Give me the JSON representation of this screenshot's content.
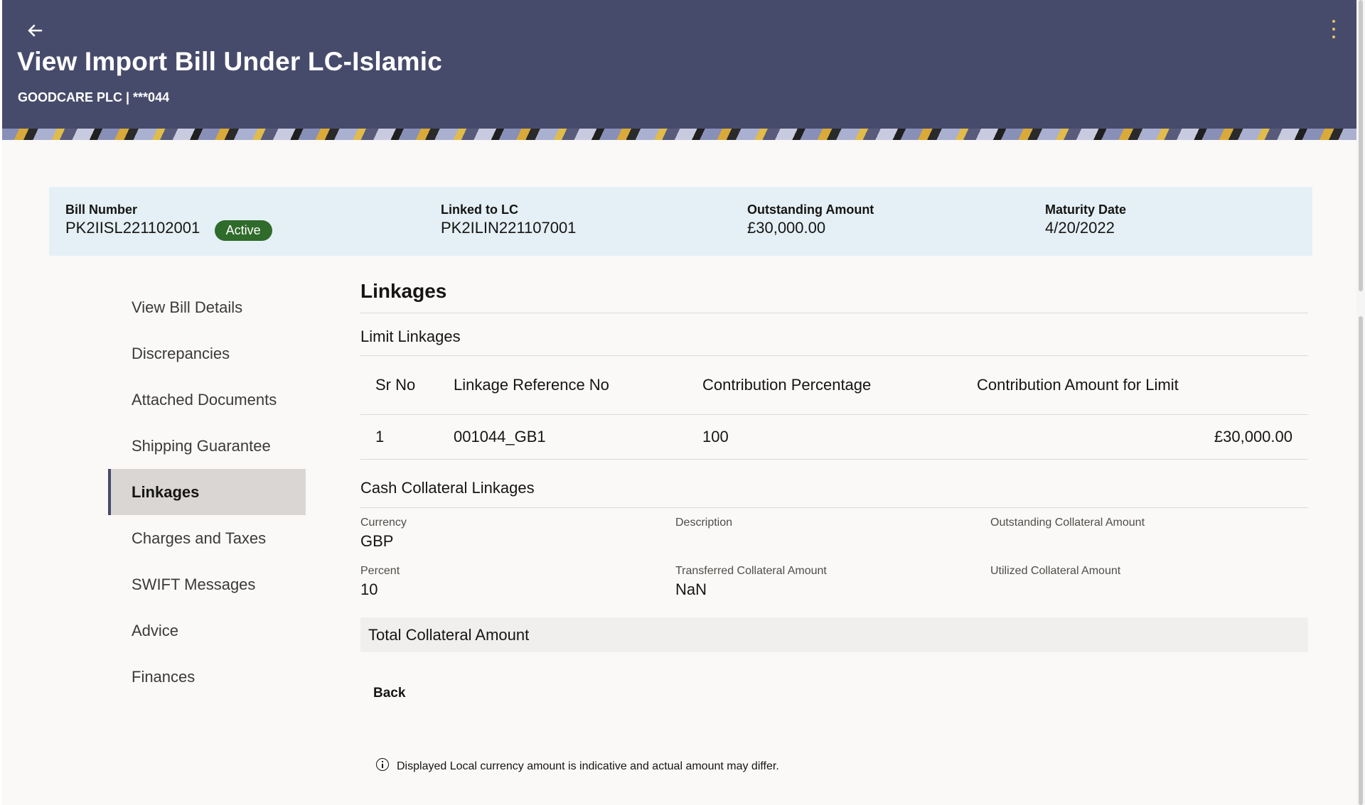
{
  "header": {
    "title": "View Import Bill Under LC-Islamic",
    "subtitle": "GOODCARE PLC | ***044"
  },
  "summary": {
    "bill_number_label": "Bill Number",
    "bill_number": "PK2IISL221102001",
    "status": "Active",
    "linked_lc_label": "Linked to LC",
    "linked_lc": "PK2ILIN221107001",
    "outstanding_label": "Outstanding Amount",
    "outstanding": "£30,000.00",
    "maturity_label": "Maturity Date",
    "maturity": "4/20/2022"
  },
  "sidenav": {
    "items": [
      {
        "label": "View Bill Details"
      },
      {
        "label": "Discrepancies"
      },
      {
        "label": "Attached Documents"
      },
      {
        "label": "Shipping Guarantee"
      },
      {
        "label": "Linkages",
        "active": true
      },
      {
        "label": "Charges and Taxes"
      },
      {
        "label": "SWIFT Messages"
      },
      {
        "label": "Advice"
      },
      {
        "label": "Finances"
      }
    ]
  },
  "linkages": {
    "title": "Linkages",
    "limit_title": "Limit Linkages",
    "limit_table": {
      "headers": [
        "Sr No",
        "Linkage Reference No",
        "Contribution Percentage",
        "Contribution Amount for Limit"
      ],
      "rows": [
        [
          "1",
          "001044_GB1",
          "100",
          "£30,000.00"
        ]
      ]
    },
    "cash_title": "Cash Collateral Linkages",
    "cash_fields": [
      {
        "label": "Currency",
        "value": "GBP"
      },
      {
        "label": "Description",
        "value": ""
      },
      {
        "label": "Outstanding Collateral Amount",
        "value": ""
      },
      {
        "label": "Percent",
        "value": "10"
      },
      {
        "label": "Transferred Collateral Amount",
        "value": "NaN"
      },
      {
        "label": "Utilized Collateral Amount",
        "value": ""
      }
    ],
    "total_label": "Total Collateral Amount"
  },
  "actions": {
    "back_label": "Back"
  },
  "note": {
    "text": "Displayed Local currency amount is indicative and actual amount may differ."
  },
  "colors": {
    "header_bg": "#474b6b",
    "summary_bg": "#e4f0f5",
    "status_badge": "#2f6b2a",
    "active_nav_bg": "#d9d6d3"
  }
}
